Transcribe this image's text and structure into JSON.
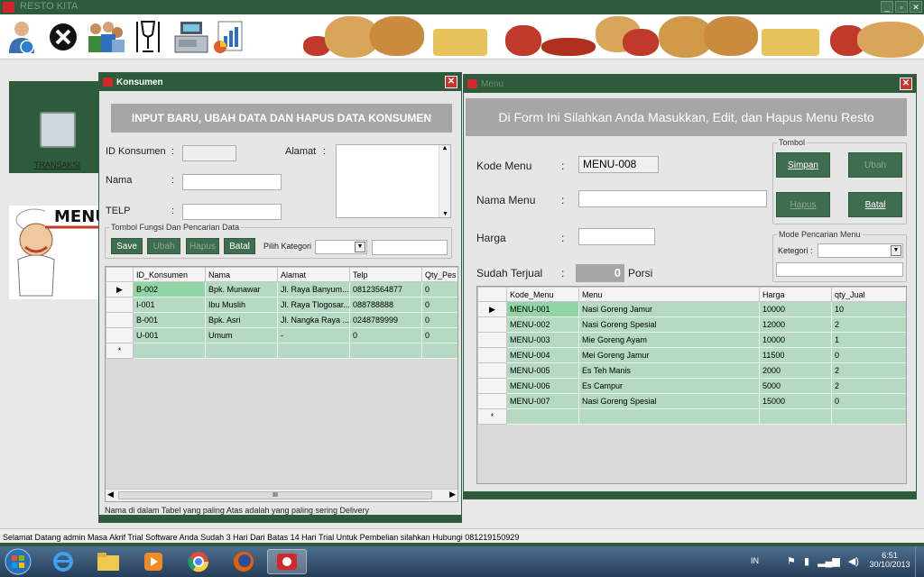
{
  "app": {
    "title": "RESTO KITA"
  },
  "window_controls": {
    "minimize": "_",
    "maximize": "▫",
    "close": "✕"
  },
  "sidebar": {
    "transaksi_label": "TRANSAKSI",
    "menu_badge_text": "MENU"
  },
  "konsumen": {
    "title": "Konsumen",
    "header": "INPUT BARU, UBAH DATA DAN HAPUS DATA KONSUMEN",
    "id_label": "ID Konsumen",
    "nama_label": "Nama",
    "telp_label": "TELP",
    "alamat_label": "Alamat",
    "colon": ":",
    "id_value": "",
    "nama_value": "",
    "telp_value": "",
    "alamat_value": "",
    "group_label": "Tombol Fungsi Dan Pencarian Data",
    "buttons": {
      "save": "Save",
      "ubah": "Ubah",
      "hapus": "Hapus",
      "batal": "Batal"
    },
    "kategori_label": "Pilih Kategori",
    "kategori_value": "",
    "search_value": "",
    "columns": [
      "ID_Konsumen",
      "Nama",
      "Alamat",
      "Telp",
      "Qty_Pes"
    ],
    "rows": [
      [
        "B-002",
        "Bpk. Munawar",
        "Jl. Raya Banyum...",
        "08123564877",
        "0"
      ],
      [
        "I-001",
        "Ibu Muslih",
        "Jl. Raya Tlogosar...",
        "088788888",
        "0"
      ],
      [
        "B-001",
        "Bpk. Asri",
        "Jl. Nangka Raya ...",
        "0248789999",
        "0"
      ],
      [
        "U-001",
        "Umum",
        "-",
        "0",
        "0"
      ]
    ],
    "new_row_marker": "*",
    "current_row_marker": "▶",
    "scroll_thumb": "III",
    "footer_note": "Nama di dalam Tabel yang paling Atas adalah yang paling sering Delivery"
  },
  "menu_form": {
    "title": "Menu",
    "header": "Di Form Ini Silahkan Anda Masukkan, Edit, dan Hapus Menu Resto",
    "kode_label": "Kode Menu",
    "nama_label": "Nama Menu",
    "harga_label": "Harga",
    "sudah_label": "Sudah Terjual",
    "colon": ":",
    "kode_value": "MENU-008",
    "nama_value": "",
    "harga_value": "",
    "sudah_value": "0",
    "porsi_label": "Porsi",
    "tombol_group": "Tombol",
    "buttons": {
      "simpan": "Simpan",
      "ubah": "Ubah",
      "hapus": "Hapus",
      "batal": "Batal"
    },
    "mode_group": "Mode Pencarian Menu",
    "kategori_label": "Ketegori :",
    "kategori_value": "",
    "search_value": "",
    "columns": [
      "Kode_Menu",
      "Menu",
      "Harga",
      "qty_Jual"
    ],
    "rows": [
      [
        "MENU-001",
        "Nasi Goreng Jamur",
        "10000",
        "10"
      ],
      [
        "MENU-002",
        "Nasi Goreng Spesial",
        "12000",
        "2"
      ],
      [
        "MENU-003",
        "Mie Goreng Ayam",
        "10000",
        "1"
      ],
      [
        "MENU-004",
        "Mei Goreng Jamur",
        "11500",
        "0"
      ],
      [
        "MENU-005",
        "Es Teh Manis",
        "2000",
        "2"
      ],
      [
        "MENU-006",
        "Es Campur",
        "5000",
        "2"
      ],
      [
        "MENU-007",
        "Nasi Goreng Spesial",
        "15000",
        "0"
      ]
    ],
    "new_row_marker": "*",
    "current_row_marker": "▶"
  },
  "statusbar": {
    "text": "Selamat Datang  admin  Masa Akrif Trial Software Anda Sudah   3  Hari  Dari Batas 14 Hari Trial  Untuk Pembelian silahkan Hubungi 081219150929"
  },
  "taskbar": {
    "language": "IN",
    "time": "6:51",
    "date": "30/10/2013"
  },
  "colors": {
    "dark_green": "#2d5b3c",
    "row_green": "#b5d9c2",
    "header_gray": "#a6a6a6"
  }
}
